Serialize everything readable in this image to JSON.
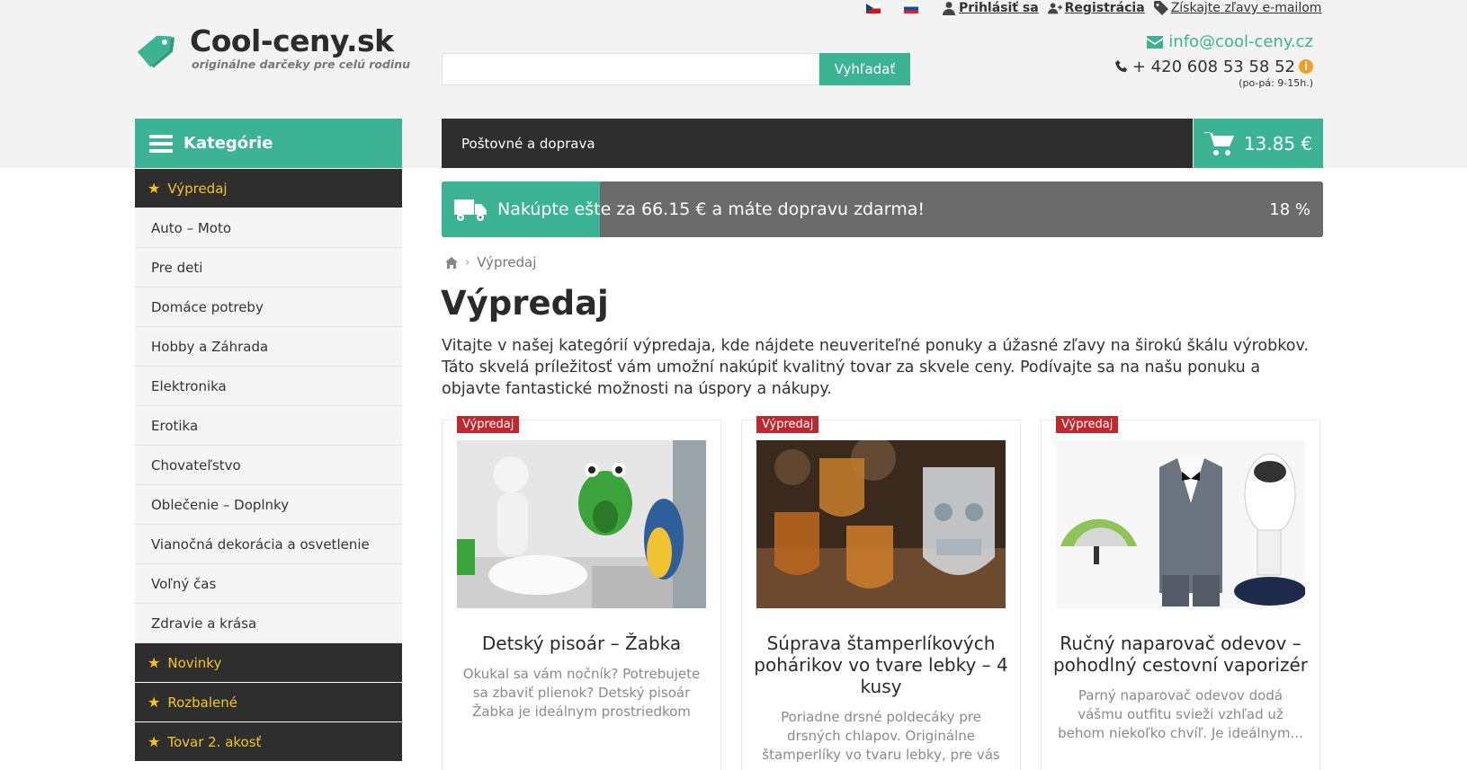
{
  "top_links": {
    "login": "Prihlásiť sa",
    "register": "Registrácia",
    "discounts": "Získajte zľavy e-mailom"
  },
  "logo": {
    "name": "Cool-ceny.sk",
    "slogan": "originálne darčeky pre celú rodinu"
  },
  "search": {
    "value": "",
    "placeholder": "",
    "button": "Vyhľadať"
  },
  "contact": {
    "email": "info@cool-ceny.cz",
    "phone": "+ 420 608 53 58 52",
    "hours": "(po-pá: 9-15h.)"
  },
  "categories": {
    "heading": "Kategórie",
    "items": [
      {
        "label": "Výpredaj",
        "highlight": true
      },
      {
        "label": "Auto – Moto",
        "highlight": false
      },
      {
        "label": "Pre deti",
        "highlight": false
      },
      {
        "label": "Domáce potreby",
        "highlight": false
      },
      {
        "label": "Hobby a Záhrada",
        "highlight": false
      },
      {
        "label": "Elektronika",
        "highlight": false
      },
      {
        "label": "Erotika",
        "highlight": false
      },
      {
        "label": "Chovateľstvo",
        "highlight": false
      },
      {
        "label": "Oblečenie – Doplnky",
        "highlight": false
      },
      {
        "label": "Vianočná dekorácia a osvetlenie",
        "highlight": false
      },
      {
        "label": "Voľný čas",
        "highlight": false
      },
      {
        "label": "Zdravie a krása",
        "highlight": false
      },
      {
        "label": "Novinky",
        "highlight": true
      },
      {
        "label": "Rozbalené",
        "highlight": true
      },
      {
        "label": "Tovar 2. akosť",
        "highlight": true
      }
    ]
  },
  "shipping_bar": {
    "label": "Poštovné a doprava"
  },
  "cart": {
    "total": "13.85 €"
  },
  "free_shipping": {
    "message": "Nakúpte ešte za 66.15 € a máte dopravu zdarma!",
    "percent_label": "18 %",
    "fraction": 0.18
  },
  "breadcrumb": {
    "current": "Výpredaj"
  },
  "page": {
    "title": "Výpredaj",
    "intro": "Vitajte v našej kategórií výpredaja, kde nájdete neuveriteľné ponuky a úžasné zľavy na širokú škálu výrobkov. Táto skvelá príležitosť vám umožní nakúpiť kvalitný tovar za skvele ceny. Podívajte sa na našu ponuku a objavte fantastické možnosti na úspory a nákupy."
  },
  "products": [
    {
      "badge": "Výpredaj",
      "title": "Detský pisoár – Žabka",
      "description": "Okukal sa vám nočník? Potrebujete sa zbaviť plienok? Detský pisoár Žabka je ideálnym prostriedkom"
    },
    {
      "badge": "Výpredaj",
      "title": "Súprava štamperlíkových pohárikov vo tvare lebky – 4 kusy",
      "description": "Poriadne drsné poldecáky pre drsných chlapov. Originálne štamperlíky vo tvaru lebky, pre vás a..."
    },
    {
      "badge": "Výpredaj",
      "title": "Ručný naparovač odevov – pohodlný cestovní vaporizér",
      "description": "Parný naparovač odevov dodá vášmu outfitu svieži vzhľad už behom niekoľko chvíľ. Je ideálnym..."
    }
  ],
  "colors": {
    "accent": "#3cb393",
    "dark": "#2e2e2e",
    "star": "#f5c518",
    "badge": "#c0282d"
  }
}
